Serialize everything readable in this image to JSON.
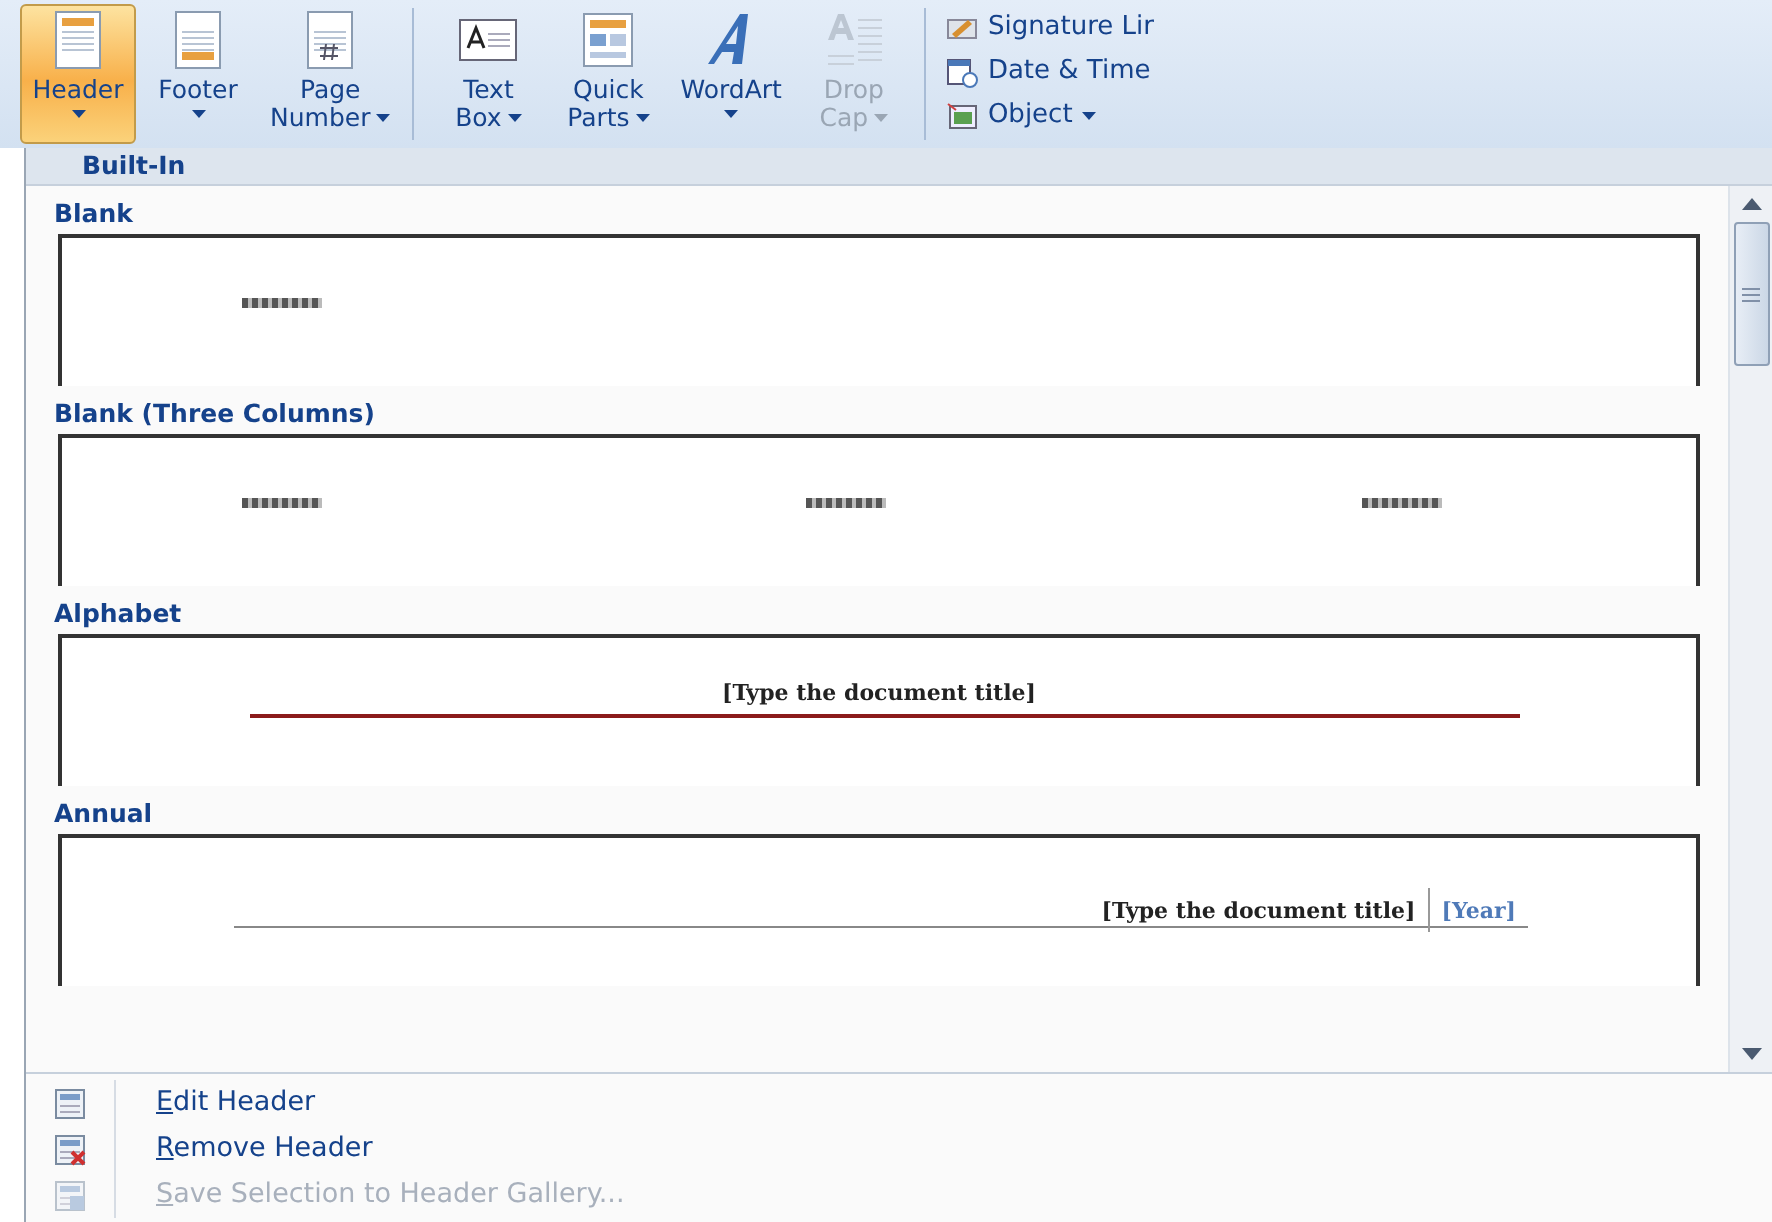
{
  "ribbon": {
    "large_buttons": [
      {
        "kind": "header",
        "lines": [
          "Header"
        ],
        "dropdown": true,
        "caret_below": true,
        "selected": true,
        "disabled": false
      },
      {
        "kind": "footer",
        "lines": [
          "Footer"
        ],
        "dropdown": true,
        "caret_below": true,
        "selected": false,
        "disabled": false
      },
      {
        "kind": "page_number",
        "lines": [
          "Page",
          "Number"
        ],
        "dropdown": true,
        "caret_below": false,
        "selected": false,
        "disabled": false
      },
      {
        "kind": "text_box",
        "lines": [
          "Text",
          "Box"
        ],
        "dropdown": true,
        "caret_below": false,
        "selected": false,
        "disabled": false
      },
      {
        "kind": "quick_parts",
        "lines": [
          "Quick",
          "Parts"
        ],
        "dropdown": true,
        "caret_below": false,
        "selected": false,
        "disabled": false
      },
      {
        "kind": "wordart",
        "lines": [
          "WordArt"
        ],
        "dropdown": true,
        "caret_below": true,
        "selected": false,
        "disabled": false
      },
      {
        "kind": "drop_cap",
        "lines": [
          "Drop",
          "Cap"
        ],
        "dropdown": true,
        "caret_below": false,
        "selected": false,
        "disabled": true
      }
    ],
    "small_buttons": [
      {
        "kind": "signature",
        "label": "Signature Lir",
        "dropdown": false
      },
      {
        "kind": "date",
        "label": "Date & Time",
        "dropdown": false
      },
      {
        "kind": "object",
        "label": "Object",
        "dropdown": true
      }
    ]
  },
  "gallery": {
    "section": "Built-In",
    "items": [
      {
        "title": "Blank",
        "kind": "blank"
      },
      {
        "title": "Blank (Three Columns)",
        "kind": "three_columns"
      },
      {
        "title": "Alphabet",
        "kind": "alphabet",
        "text": "[Type the document title]"
      },
      {
        "title": "Annual",
        "kind": "annual",
        "text": "[Type the document title]",
        "year": "[Year]"
      }
    ]
  },
  "menu": [
    {
      "kind": "edit",
      "label": "Edit Header",
      "disabled": false
    },
    {
      "kind": "remove",
      "label": "Remove Header",
      "disabled": false
    },
    {
      "kind": "save",
      "label": "Save Selection to Header Gallery...",
      "disabled": true
    }
  ]
}
